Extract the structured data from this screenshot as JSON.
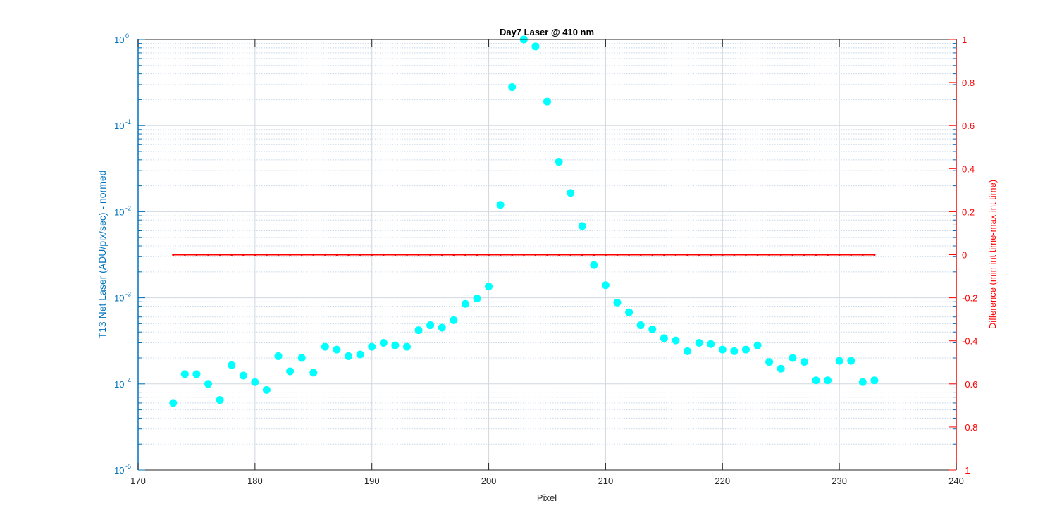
{
  "chart_data": {
    "type": "scatter",
    "title": "Day7 Laser @ 410 nm",
    "xlabel": "Pixel",
    "ylabel_left": "T13 Net Laser (ADU/pix/sec) - normed",
    "ylabel_right": "Difference (min int time-max int time)",
    "xlim": [
      170,
      240
    ],
    "xticks": [
      170,
      180,
      190,
      200,
      210,
      220,
      230,
      240
    ],
    "ylim_left": [
      1e-05,
      1
    ],
    "yscale_left": "log",
    "yticks_left": [
      {
        "base": "10",
        "exp": "-5"
      },
      {
        "base": "10",
        "exp": "-4"
      },
      {
        "base": "10",
        "exp": "-3"
      },
      {
        "base": "10",
        "exp": "-2"
      },
      {
        "base": "10",
        "exp": "-1"
      },
      {
        "base": "10",
        "exp": "0"
      }
    ],
    "ylim_right": [
      -1,
      1
    ],
    "yticks_right": [
      "-1",
      "-0.8",
      "-0.6",
      "-0.4",
      "-0.2",
      "0",
      "0.2",
      "0.4",
      "0.6",
      "0.8",
      "1"
    ],
    "grid": true,
    "colors": {
      "normed": "#00FFFF",
      "difference": "#FF0000",
      "left_axis": "#0072BD",
      "right_axis": "#FF0000",
      "grid": "#c8d8e8"
    },
    "series": [
      {
        "axis": "left",
        "style": "markers",
        "x": [
          173,
          174,
          175,
          176,
          177,
          178,
          179,
          180,
          181,
          182,
          183,
          184,
          185,
          186,
          187,
          188,
          189,
          190,
          191,
          192,
          193,
          194,
          195,
          196,
          197,
          198,
          199,
          200,
          201,
          202,
          203,
          204,
          205,
          206,
          207,
          208,
          209,
          210,
          211,
          212,
          213,
          214,
          215,
          216,
          217,
          218,
          219,
          220,
          221,
          222,
          223,
          224,
          225,
          226,
          227,
          228,
          229,
          230,
          231,
          232,
          233
        ],
        "y": [
          6e-05,
          0.00013,
          0.00013,
          0.0001,
          6.5e-05,
          0.000165,
          0.000125,
          0.000105,
          8.5e-05,
          0.00021,
          0.00014,
          0.0002,
          0.000135,
          0.00027,
          0.00025,
          0.00021,
          0.00022,
          0.00027,
          0.0003,
          0.00028,
          0.00027,
          0.00042,
          0.00048,
          0.00045,
          0.00055,
          0.00085,
          0.00098,
          0.00135,
          0.012,
          0.28,
          1.0,
          0.83,
          0.19,
          0.038,
          0.0165,
          0.0068,
          0.0024,
          0.0014,
          0.00088,
          0.00068,
          0.00048,
          0.00043,
          0.00034,
          0.00032,
          0.00024,
          0.0003,
          0.00029,
          0.00025,
          0.00024,
          0.00025,
          0.00028,
          0.00018,
          0.00015,
          0.0002,
          0.00018,
          0.00011,
          0.00011,
          0.000185,
          0.000185,
          0.000105,
          0.00011
        ]
      },
      {
        "axis": "right",
        "style": "line-with-dot-markers",
        "x_range": [
          173,
          233
        ],
        "y": 0
      }
    ]
  }
}
